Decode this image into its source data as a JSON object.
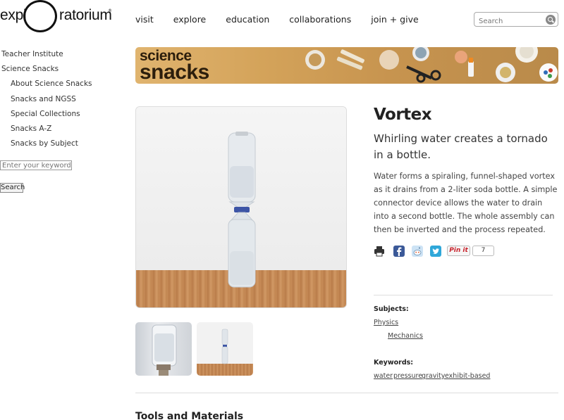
{
  "logo": {
    "left": "expl",
    "right": "ratorium",
    "mark": "®"
  },
  "nav": [
    "visit",
    "explore",
    "education",
    "collaborations",
    "join + give"
  ],
  "search": {
    "placeholder": "Search"
  },
  "sidebar": {
    "items": [
      {
        "label": "Teacher Institute",
        "level": 0
      },
      {
        "label": "Science Snacks",
        "level": 0
      },
      {
        "label": "About Science Snacks",
        "level": 1
      },
      {
        "label": "Snacks and NGSS",
        "level": 1
      },
      {
        "label": "Special Collections",
        "level": 1
      },
      {
        "label": "Snacks A-Z",
        "level": 1
      },
      {
        "label": "Snacks by Subject",
        "level": 1
      }
    ],
    "search_placeholder": "Enter your keywords",
    "search_button": "Search"
  },
  "banner": {
    "line1": "science",
    "line2": "snacks"
  },
  "article": {
    "title": "Vortex",
    "subtitle": "Whirling water creates a tornado in a bottle.",
    "description": "Water forms a spiraling, funnel-shaped vortex as it drains from a 2-liter soda bottle. A simple connector device allows the water to drain into a second bottle. The whole assembly can then be inverted and the process repeated."
  },
  "share": {
    "icons": [
      "print-icon",
      "facebook-icon",
      "reddit-icon",
      "twitter-icon"
    ],
    "pin_label": "Pin it",
    "pin_count": "7"
  },
  "subjects": {
    "label": "Subjects:",
    "items": [
      "Physics",
      "Mechanics"
    ]
  },
  "keywords": {
    "label": "Keywords:",
    "items": [
      "water",
      "pressure",
      "gravity",
      "exhibit-based"
    ]
  },
  "section": {
    "tools_heading": "Tools and Materials"
  },
  "colors": {
    "banner": "#c7944f",
    "facebook": "#3b5998",
    "twitter": "#2fa7d9",
    "pinterest": "#c8232c"
  }
}
